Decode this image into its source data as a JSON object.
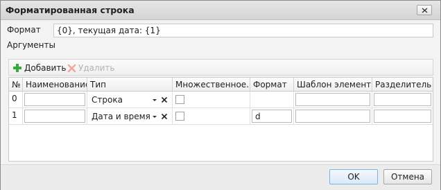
{
  "window": {
    "title": "Форматированная строка"
  },
  "format": {
    "label": "Формат",
    "value": "{0}, текущая дата: {1}"
  },
  "arguments": {
    "label": "Аргументы"
  },
  "toolbar": {
    "add_label": "Добавить",
    "delete_label": "Удалить"
  },
  "grid": {
    "headers": [
      "№",
      "Наименование",
      "Тип",
      "Множественное...",
      "Формат",
      "Шаблон элемента",
      "Разделитель"
    ],
    "rows": [
      {
        "num": "0",
        "name": "",
        "type": "Строка",
        "multiple": false,
        "format": "",
        "template": "",
        "separator": ""
      },
      {
        "num": "1",
        "name": "",
        "type": "Дата и время",
        "multiple": false,
        "format": "d",
        "template": "",
        "separator": ""
      }
    ]
  },
  "footer": {
    "ok_label": "OK",
    "cancel_label": "Отмена"
  }
}
